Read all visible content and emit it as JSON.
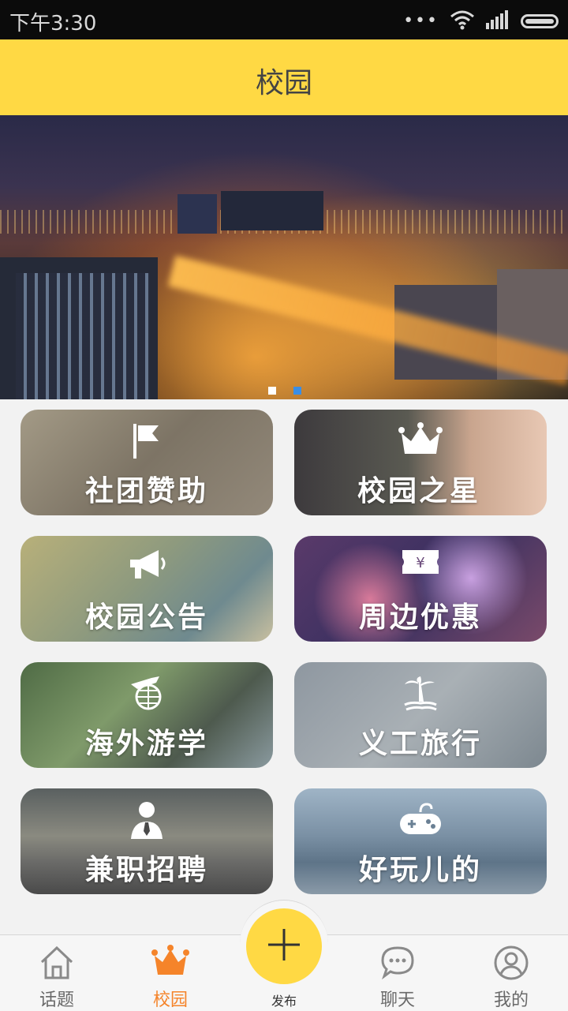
{
  "status_bar": {
    "time": "下午3:30",
    "dots": "•••"
  },
  "header": {
    "title": "校园"
  },
  "banner": {
    "pages": 2,
    "active_page": 2
  },
  "grid": [
    {
      "label": "社团赞助",
      "icon": "flag-icon"
    },
    {
      "label": "校园之星",
      "icon": "crown-icon"
    },
    {
      "label": "校园公告",
      "icon": "megaphone-icon"
    },
    {
      "label": "周边优惠",
      "icon": "coupon-icon"
    },
    {
      "label": "海外游学",
      "icon": "plane-globe-icon"
    },
    {
      "label": "义工旅行",
      "icon": "palm-island-icon"
    },
    {
      "label": "兼职招聘",
      "icon": "person-tie-icon"
    },
    {
      "label": "好玩儿的",
      "icon": "gamepad-icon"
    }
  ],
  "tabbar": {
    "items": [
      {
        "label": "话题",
        "icon": "home-icon",
        "active": false
      },
      {
        "label": "校园",
        "icon": "crown-icon",
        "active": true
      },
      {
        "label": "聊天",
        "icon": "chat-bubble-icon",
        "active": false
      },
      {
        "label": "我的",
        "icon": "user-icon",
        "active": false
      }
    ],
    "publish_label": "发布"
  },
  "colors": {
    "accent": "#ffd944",
    "active_tab": "#f5842a",
    "inactive_tab": "#8a8a8a",
    "pager_active": "#3a8ee6",
    "pager_inactive": "#ffffff"
  }
}
